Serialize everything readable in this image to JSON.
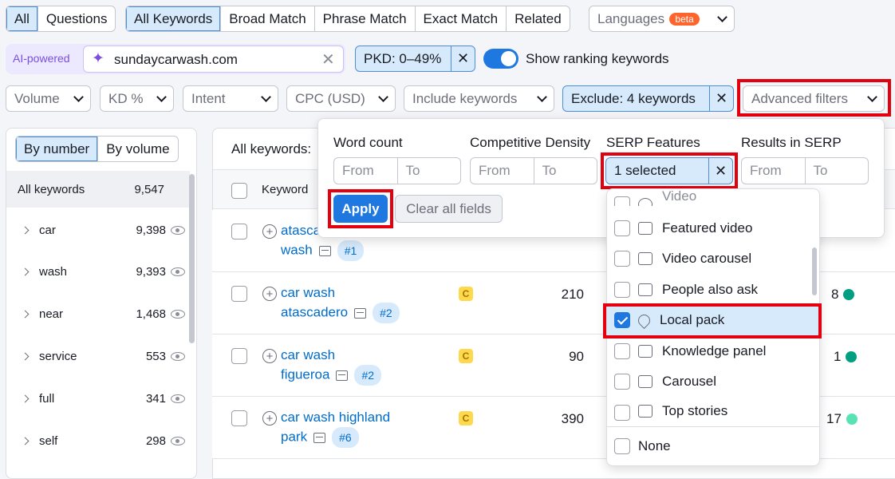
{
  "top_tabs": {
    "all": "All",
    "questions": "Questions"
  },
  "match_tabs": {
    "all_keywords": "All Keywords",
    "broad": "Broad Match",
    "phrase": "Phrase Match",
    "exact": "Exact Match",
    "related": "Related"
  },
  "languages": {
    "label": "Languages",
    "badge": "beta"
  },
  "ai": {
    "label": "AI-powered",
    "domain": "sundaycarwash.com"
  },
  "pkd_filter": "PKD: 0–49%",
  "ranking_toggle": "Show ranking keywords",
  "filters": {
    "volume": "Volume",
    "kd": "KD %",
    "intent": "Intent",
    "cpc": "CPC (USD)",
    "include": "Include keywords",
    "exclude": "Exclude: 4 keywords",
    "advanced": "Advanced filters"
  },
  "sidebar": {
    "by_number": "By number",
    "by_volume": "By volume",
    "all_label": "All keywords",
    "all_count": "9,547",
    "items": [
      {
        "label": "car",
        "count": "9,398"
      },
      {
        "label": "wash",
        "count": "9,393"
      },
      {
        "label": "near",
        "count": "1,468"
      },
      {
        "label": "service",
        "count": "553"
      },
      {
        "label": "full",
        "count": "341"
      },
      {
        "label": "self",
        "count": "298"
      }
    ]
  },
  "table": {
    "all_keywords_label": "All keywords:",
    "col_keyword": "Keyword",
    "rows": [
      {
        "kw1": "atasca",
        "kw2": "wash",
        "rank": "#1",
        "intent": "",
        "volume": "",
        "kd": ""
      },
      {
        "kw1": "car wash",
        "kw2": "atascadero",
        "rank": "#2",
        "intent": "C",
        "volume": "210",
        "kd": "8"
      },
      {
        "kw1": "car wash",
        "kw2": "figueroa",
        "rank": "#2",
        "intent": "C",
        "volume": "90",
        "kd": "1"
      },
      {
        "kw1": "car wash highland",
        "kw2": "park",
        "rank": "#6",
        "intent": "C",
        "volume": "390",
        "kd": "17"
      }
    ],
    "dot_colors": [
      "#009f81",
      "#009f81",
      "#59e3b4"
    ]
  },
  "advanced": {
    "word_count": "Word count",
    "competitive_density": "Competitive Density",
    "serp_features": "SERP Features",
    "results_in_serp": "Results in SERP",
    "from": "From",
    "to": "To",
    "selected": "1 selected",
    "apply": "Apply",
    "clear": "Clear all fields",
    "options": [
      {
        "label": "Video",
        "checked": false
      },
      {
        "label": "Featured video",
        "checked": false
      },
      {
        "label": "Video carousel",
        "checked": false
      },
      {
        "label": "People also ask",
        "checked": false
      },
      {
        "label": "Local pack",
        "checked": true
      },
      {
        "label": "Knowledge panel",
        "checked": false
      },
      {
        "label": "Carousel",
        "checked": false
      },
      {
        "label": "Top stories",
        "checked": false
      }
    ],
    "none": "None"
  },
  "colors": {
    "accent": "#006dca",
    "apply": "#1f78e0",
    "highlight": "#e3000f",
    "selected_bg": "#d7eafc"
  }
}
